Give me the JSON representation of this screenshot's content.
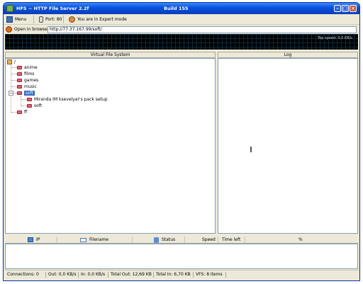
{
  "window": {
    "title": "HFS ~ HTTP File Server 2.2f",
    "build": "Build 155"
  },
  "toolbar": {
    "menu_label": "Menu",
    "port_label": "Port: 80",
    "mode_label": "You are in Expert mode"
  },
  "urlbar": {
    "open_label": "Open in browser",
    "url": "http://77.37.167.99/soft/"
  },
  "graph": {
    "top_speed": "Top speed: 0,0 KB/s"
  },
  "vfs": {
    "header": "Virtual File System",
    "root": "/",
    "items": [
      "anime",
      "films",
      "games",
      "music",
      "soft",
      "ff"
    ],
    "selected": "soft",
    "children": [
      "Miranda IM ksevelyar's pack setup",
      "soft"
    ]
  },
  "log": {
    "header": "Log"
  },
  "connections": {
    "columns": [
      "IP",
      "Filename",
      "Status",
      "Speed",
      "Time left",
      "%"
    ]
  },
  "status": {
    "connections": "Connections: 0",
    "out": "Out: 0,0 KB/s",
    "in": "In: 0,0 KB/s",
    "total_out": "Total Out: 12,69 KB",
    "total_in": "Total In: 6,70 KB",
    "vfs": "VFS: 8 items"
  },
  "colors": {
    "title_bar": "#0a54e3",
    "selection": "#316ac5",
    "folder": "#e85d6a",
    "graph_bg": "#000000"
  }
}
